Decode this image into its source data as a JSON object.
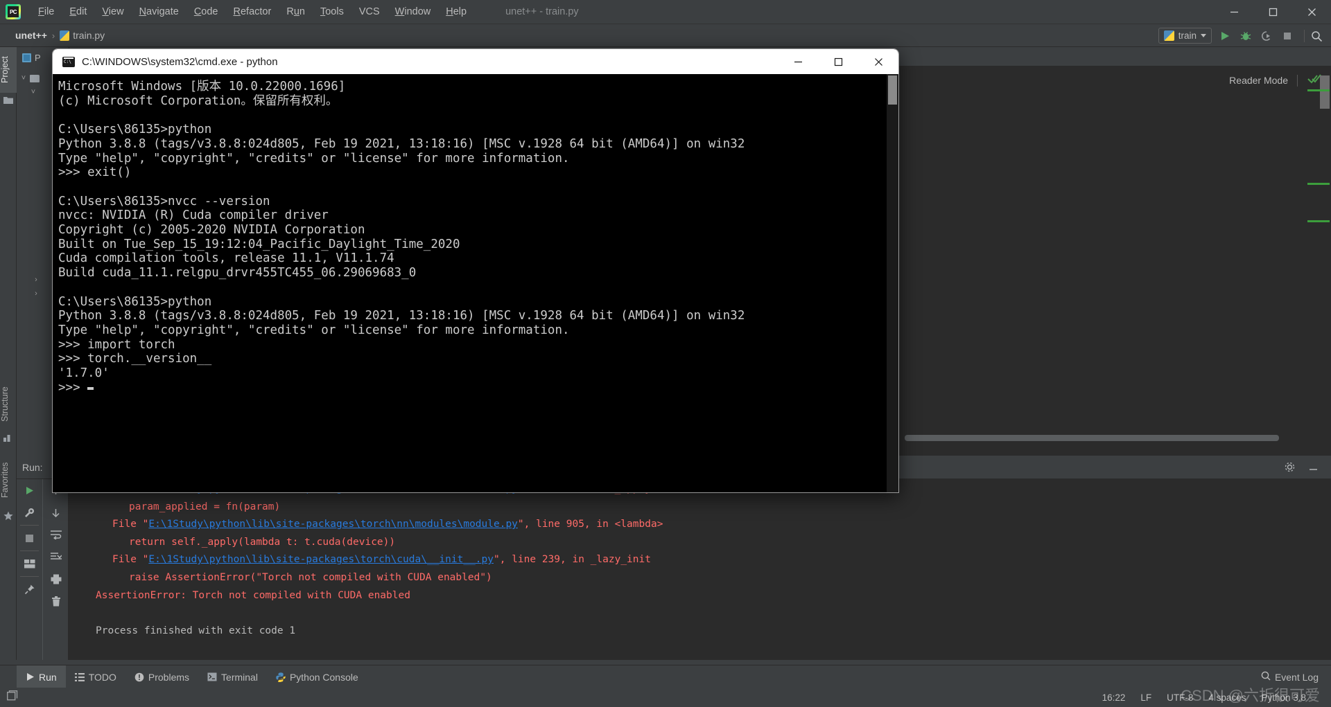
{
  "window": {
    "title": "unet++ - train.py",
    "controls": [
      "minimize",
      "maximize",
      "close"
    ]
  },
  "menubar": {
    "logo": "pycharm-logo",
    "items": [
      {
        "label": "File",
        "mnemonic": "F"
      },
      {
        "label": "Edit",
        "mnemonic": "E"
      },
      {
        "label": "View",
        "mnemonic": "V"
      },
      {
        "label": "Navigate",
        "mnemonic": "N"
      },
      {
        "label": "Code",
        "mnemonic": "C"
      },
      {
        "label": "Refactor",
        "mnemonic": "R"
      },
      {
        "label": "Run",
        "mnemonic": "u"
      },
      {
        "label": "Tools",
        "mnemonic": "T"
      },
      {
        "label": "VCS",
        "mnemonic": ""
      },
      {
        "label": "Window",
        "mnemonic": "W"
      },
      {
        "label": "Help",
        "mnemonic": "H"
      }
    ]
  },
  "breadcrumb": {
    "project": "unet++",
    "separator": "›",
    "file": "train.py"
  },
  "toolbar": {
    "run_config": "train",
    "buttons": [
      "run-icon",
      "debug-icon",
      "run-coverage-icon",
      "stop-icon",
      "search-icon"
    ]
  },
  "left_tool_window": {
    "tabs": [
      {
        "label": "Project",
        "icon": "folder-icon",
        "active": true
      },
      {
        "label": "Structure",
        "icon": "structure-icon",
        "active": false
      },
      {
        "label": "Favorites",
        "icon": "star-icon",
        "active": false
      }
    ]
  },
  "project_panel": {
    "header": "P",
    "header_icon": "project-icon"
  },
  "editor": {
    "reader_mode": "Reader Mode",
    "inspection_icon": "double-check-icon"
  },
  "run_panel": {
    "title": "Run:",
    "tab_icon": "console-icon",
    "left_tools": [
      "rerun-icon",
      "settings-wrench-icon",
      "stop-icon",
      "layout-icon",
      "pin-icon"
    ],
    "right_tools": [
      "up-arrow-icon",
      "down-arrow-icon",
      "soft-wrap-icon",
      "scroll-to-end-icon",
      "print-icon",
      "trash-icon"
    ],
    "header_tools": [
      "gear-icon",
      "minimize-icon"
    ],
    "console_lines": [
      {
        "indent": 2,
        "segments": [
          {
            "t": "File \"",
            "c": "red"
          },
          {
            "t": "E:\\1Study\\python\\lib\\site-packages\\torch\\nn\\modules\\module.py",
            "c": "link"
          },
          {
            "t": "\", line 820, in _apply",
            "c": "red"
          }
        ]
      },
      {
        "indent": 3,
        "segments": [
          {
            "t": "param_applied = fn(param)",
            "c": "red"
          }
        ]
      },
      {
        "indent": 2,
        "segments": [
          {
            "t": "File \"",
            "c": "red"
          },
          {
            "t": "E:\\1Study\\python\\lib\\site-packages\\torch\\nn\\modules\\module.py",
            "c": "link"
          },
          {
            "t": "\", line 905, in <lambda>",
            "c": "red"
          }
        ]
      },
      {
        "indent": 3,
        "segments": [
          {
            "t": "return self._apply(lambda t: t.cuda(device))",
            "c": "red"
          }
        ]
      },
      {
        "indent": 2,
        "segments": [
          {
            "t": "File \"",
            "c": "red"
          },
          {
            "t": "E:\\1Study\\python\\lib\\site-packages\\torch\\cuda\\__init__.py",
            "c": "link"
          },
          {
            "t": "\", line 239, in _lazy_init",
            "c": "red"
          }
        ]
      },
      {
        "indent": 3,
        "segments": [
          {
            "t": "raise AssertionError(\"Torch not compiled with CUDA enabled\")",
            "c": "red"
          }
        ]
      },
      {
        "indent": 1,
        "segments": [
          {
            "t": "AssertionError: Torch not compiled with CUDA enabled",
            "c": "red"
          }
        ]
      },
      {
        "indent": 0,
        "segments": [
          {
            "t": "",
            "c": "grey"
          }
        ]
      },
      {
        "indent": 1,
        "segments": [
          {
            "t": "Process finished with exit code 1",
            "c": "grey"
          }
        ]
      }
    ]
  },
  "bottom_tabs": [
    {
      "label": "Run",
      "icon": "run-icon",
      "active": true
    },
    {
      "label": "TODO",
      "icon": "todo-icon",
      "active": false
    },
    {
      "label": "Problems",
      "icon": "problems-icon",
      "active": false
    },
    {
      "label": "Terminal",
      "icon": "terminal-icon",
      "active": false
    },
    {
      "label": "Python Console",
      "icon": "python-icon",
      "active": false
    }
  ],
  "event_log": {
    "label": "Event Log",
    "icon": "event-log-icon"
  },
  "statusbar": {
    "items": [
      "16:22",
      "LF",
      "UTF-8",
      "4 spaces",
      "Python 3.8"
    ],
    "left_icon": "layout-toggle-icon"
  },
  "watermark": "CSDN @六折很可爱",
  "cmd_window": {
    "title": "C:\\WINDOWS\\system32\\cmd.exe - python",
    "icon": "cmd-icon",
    "controls": [
      "minimize",
      "maximize",
      "close"
    ],
    "lines": [
      "Microsoft Windows [版本 10.0.22000.1696]",
      "(c) Microsoft Corporation。保留所有权利。",
      "",
      "C:\\Users\\86135>python",
      "Python 3.8.8 (tags/v3.8.8:024d805, Feb 19 2021, 13:18:16) [MSC v.1928 64 bit (AMD64)] on win32",
      "Type \"help\", \"copyright\", \"credits\" or \"license\" for more information.",
      ">>> exit()",
      "",
      "C:\\Users\\86135>nvcc --version",
      "nvcc: NVIDIA (R) Cuda compiler driver",
      "Copyright (c) 2005-2020 NVIDIA Corporation",
      "Built on Tue_Sep_15_19:12:04_Pacific_Daylight_Time_2020",
      "Cuda compilation tools, release 11.1, V11.1.74",
      "Build cuda_11.1.relgpu_drvr455TC455_06.29069683_0",
      "",
      "C:\\Users\\86135>python",
      "Python 3.8.8 (tags/v3.8.8:024d805, Feb 19 2021, 13:18:16) [MSC v.1928 64 bit (AMD64)] on win32",
      "Type \"help\", \"copyright\", \"credits\" or \"license\" for more information.",
      ">>> import torch",
      ">>> torch.__version__",
      "'1.7.0'"
    ],
    "prompt": ">>> "
  },
  "colors": {
    "chrome": "#3c3f41",
    "editor_bg": "#2b2b2b",
    "console_bg": "#000000",
    "error_red": "#ff6b68",
    "link_blue": "#287bde",
    "accent_green": "#3c9e3c",
    "text": "#bbbbbb"
  }
}
